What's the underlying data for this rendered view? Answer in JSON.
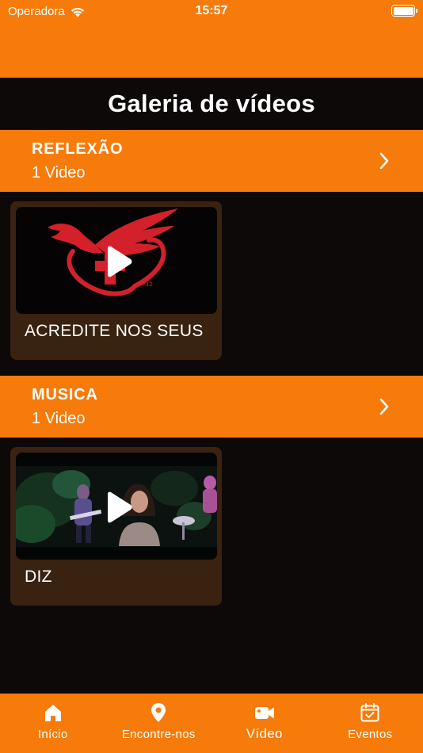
{
  "status_bar": {
    "carrier": "Operadora",
    "time": "15:57",
    "icons": [
      "wifi-icon",
      "battery-icon"
    ]
  },
  "header": {
    "title": "Galeria de vídeos"
  },
  "categories": [
    {
      "title": "REFLEXÃO",
      "count": "1 Video",
      "videos": [
        {
          "title": "ACREDITE NOS SEUS",
          "thumbnail": "red-eagle-cross-logo"
        }
      ]
    },
    {
      "title": "MUSICA",
      "count": "1 Video",
      "videos": [
        {
          "title": "DIZ",
          "thumbnail": "night-band-scene"
        }
      ]
    }
  ],
  "tab_bar": {
    "active": "Vídeo",
    "tabs": [
      {
        "label": "Início",
        "icon": "home-icon"
      },
      {
        "label": "Encontre-nos",
        "icon": "location-pin-icon"
      },
      {
        "label": "Vídeo",
        "icon": "video-camera-icon"
      },
      {
        "label": "Eventos",
        "icon": "calendar-check-icon"
      }
    ]
  },
  "colors": {
    "accent": "#f77b0a",
    "background": "#0e0909",
    "card": "#3a2210",
    "logo_red": "#d4202a"
  }
}
